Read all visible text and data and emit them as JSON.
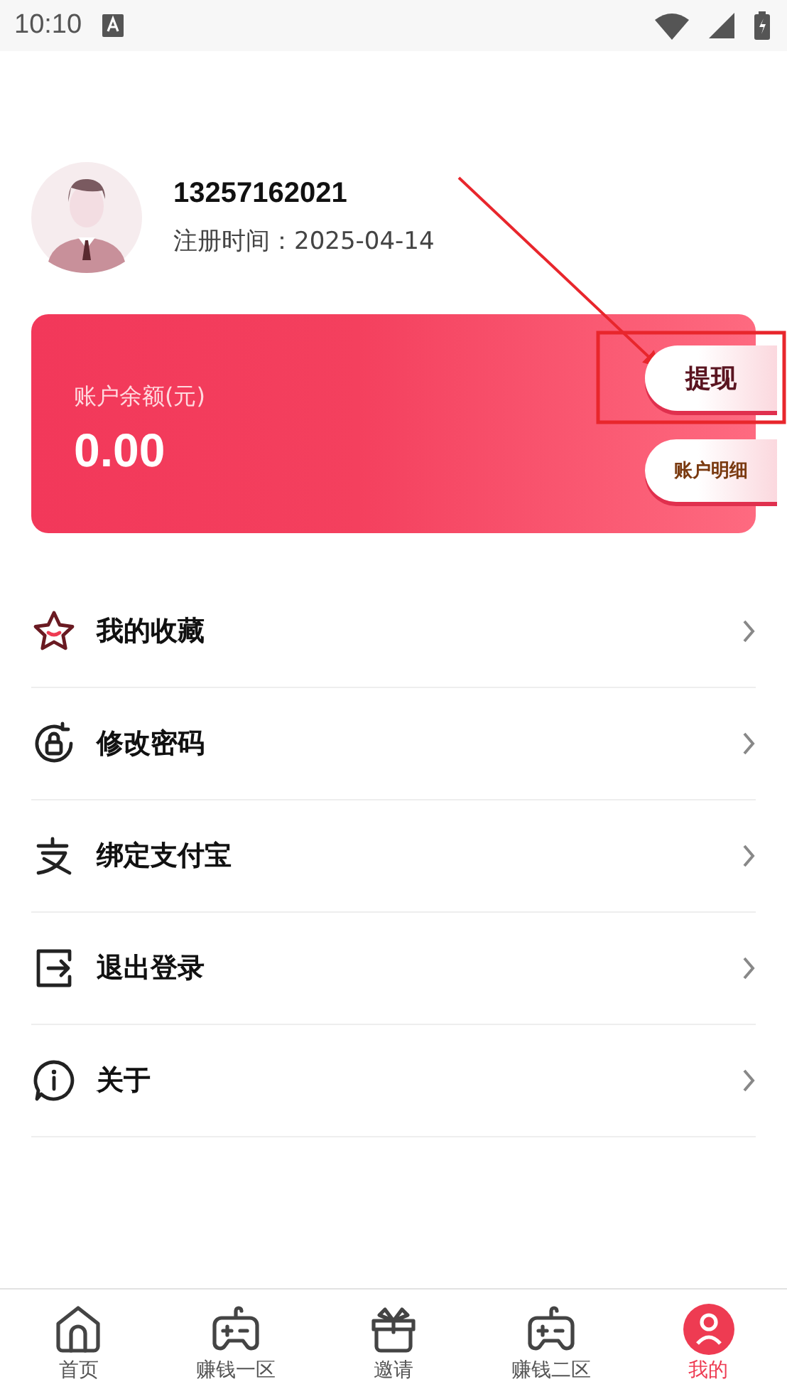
{
  "status_bar": {
    "time": "10:10"
  },
  "profile": {
    "phone": "13257162021",
    "registered": "注册时间：2025-04-14"
  },
  "balance_card": {
    "label": "账户余额(元)",
    "amount": "0.00",
    "buttons": [
      "提现",
      "账户明细"
    ]
  },
  "menu": [
    {
      "kind": "favorites",
      "label": "我的收藏"
    },
    {
      "kind": "password",
      "label": "修改密码"
    },
    {
      "kind": "alipay",
      "label": "绑定支付宝"
    },
    {
      "kind": "logout",
      "label": "退出登录"
    },
    {
      "kind": "about",
      "label": "关于"
    }
  ],
  "tab_bar": [
    {
      "kind": "home",
      "label": "首页",
      "selected": false
    },
    {
      "kind": "game",
      "label": "赚钱一区",
      "selected": false
    },
    {
      "kind": "gift",
      "label": "邀请",
      "selected": false
    },
    {
      "kind": "game2",
      "label": "赚钱二区",
      "selected": false
    },
    {
      "kind": "me",
      "label": "我的",
      "selected": true
    }
  ]
}
